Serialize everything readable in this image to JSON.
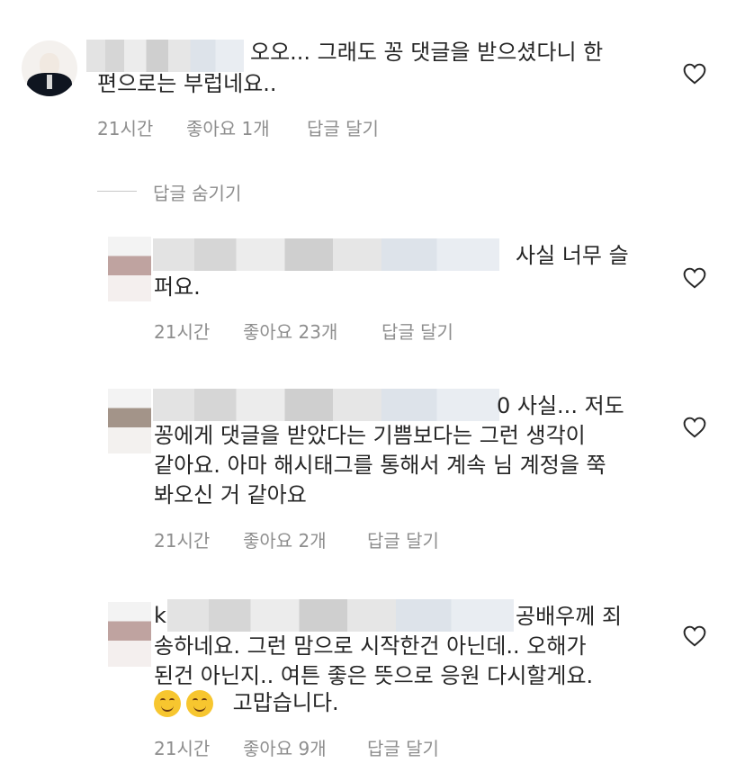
{
  "comments": [
    {
      "username_visible": "",
      "text_line1": "오오... 그래도 꽁 댓글을 받으셨다니 한",
      "text_line2": "편으로는 부럽네요..",
      "time": "21시간",
      "likes": "좋아요 1개",
      "reply": "답글 달기"
    },
    {
      "username_visible": "",
      "text_line1": "사실 너무 슬",
      "text_line2": "퍼요.",
      "time": "21시간",
      "likes": "좋아요 23개",
      "reply": "답글 달기"
    },
    {
      "username_visible": "",
      "text_line1": "0 사실... 저도",
      "text_line2": "꽁에게 댓글을 받았다는 기쁨보다는 그런 생각이",
      "text_line3": "같아요. 아마 해시태그를 통해서 계속 님 계정을 쭉",
      "text_line4": "봐오신 거 같아요",
      "time": "21시간",
      "likes": "좋아요 2개",
      "reply": "답글 달기"
    },
    {
      "username_visible": "k",
      "text_line1": "공배우께 죄",
      "text_line2": "송하네요. 그런 맘으로 시작한건 아닌데.. 오해가",
      "text_line3": "된건 아닌지.. 여튼 좋은 뜻으로 응원 다시할게요.",
      "text_line4": "고맙습니다.",
      "time": "21시간",
      "likes": "좋아요 9개",
      "reply": "답글 달기"
    }
  ],
  "hide_replies": "답글 숨기기",
  "icons": {
    "like": "heart-outline-icon",
    "emoji": "smiling-face-icon"
  },
  "colors": {
    "text": "#262626",
    "meta": "#8e8e8e",
    "heart": "#262626"
  }
}
